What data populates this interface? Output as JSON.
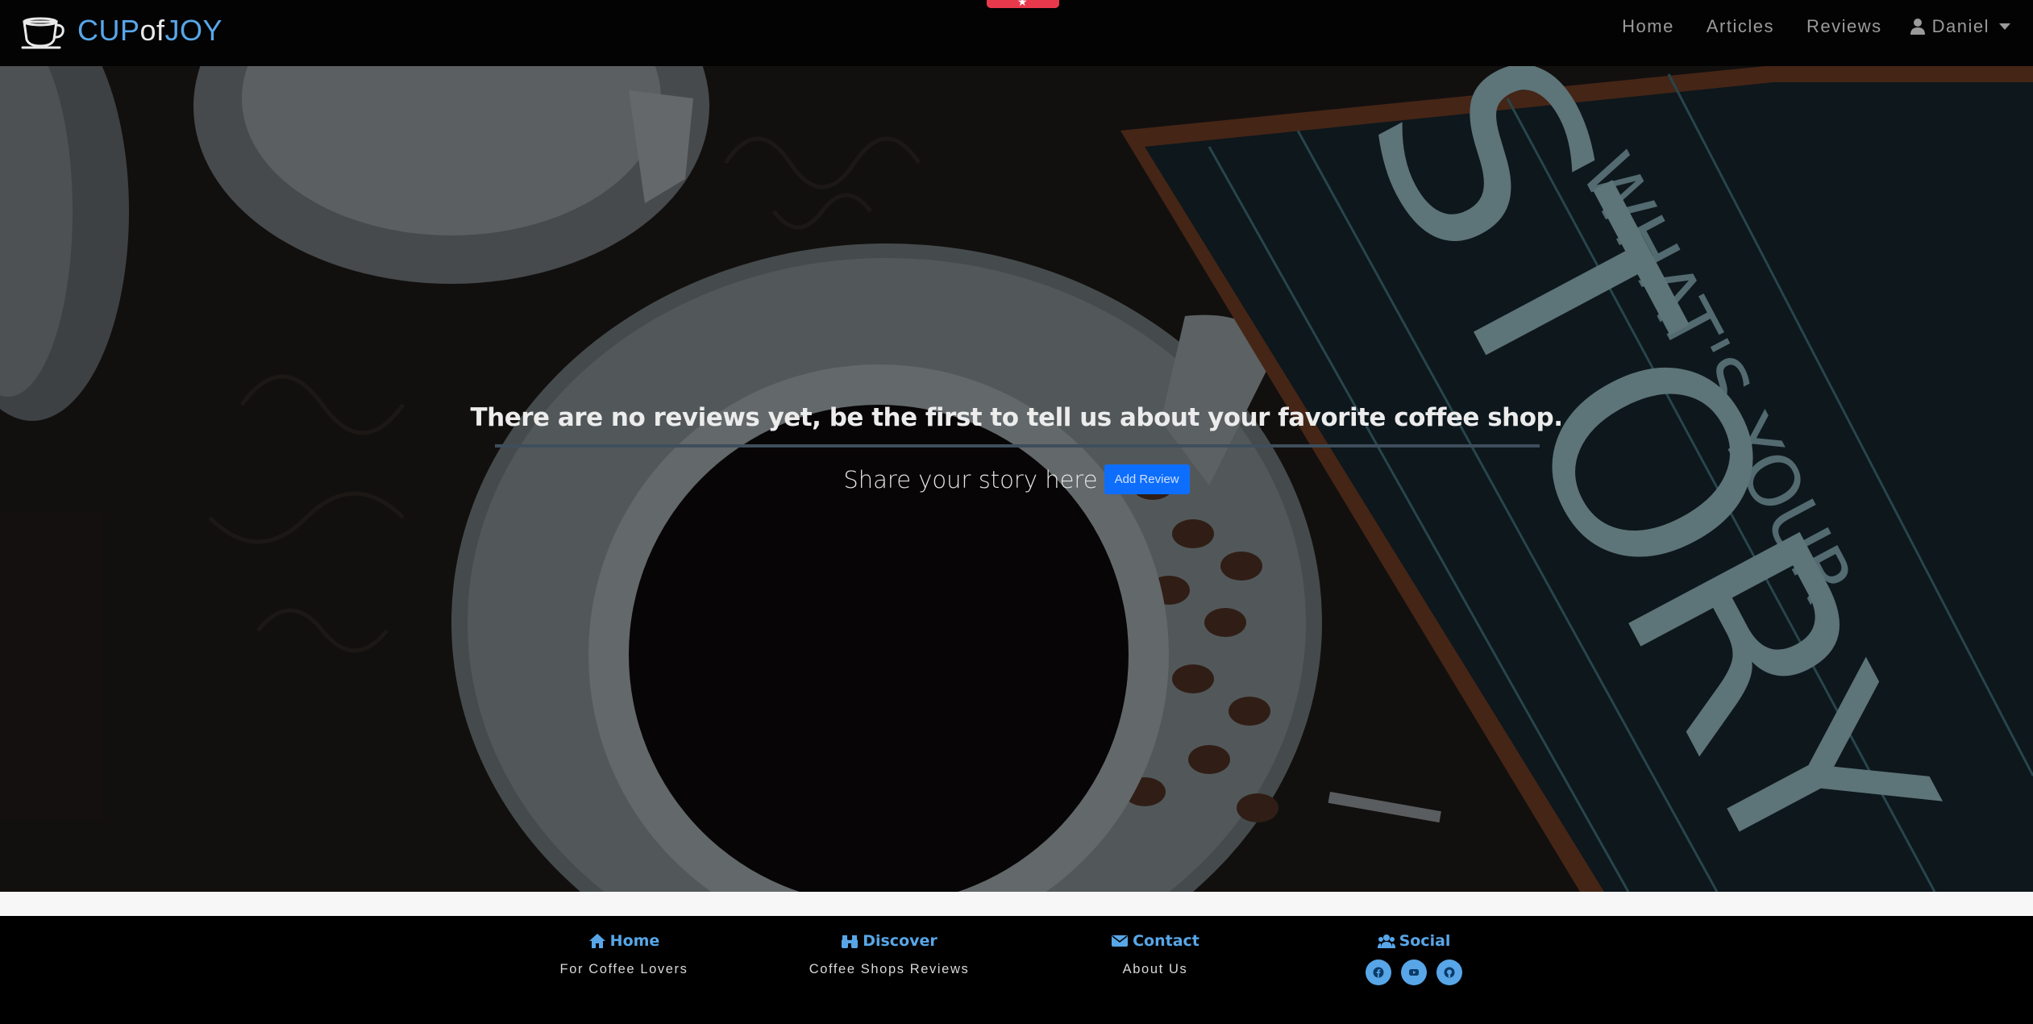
{
  "brand": {
    "part1": "CUP",
    "part2": "of",
    "part3": "JOY"
  },
  "nav": {
    "links": [
      "Home",
      "Articles",
      "Reviews"
    ],
    "user": "Daniel"
  },
  "hero": {
    "heading": "There are no reviews yet, be the first to tell us about your favorite coffee shop.",
    "share_text": "Share your story here",
    "add_review_label": "Add Review",
    "chalkboard_text_1": "WHAT'S YOUR",
    "chalkboard_text_2": "STORY"
  },
  "footer": {
    "columns": [
      {
        "heading": "Home",
        "icon": "home-icon",
        "sub": "For Coffee Lovers"
      },
      {
        "heading": "Discover",
        "icon": "binoculars-icon",
        "sub": "Coffee Shops Reviews"
      },
      {
        "heading": "Contact",
        "icon": "envelope-icon",
        "sub": "About Us"
      },
      {
        "heading": "Social",
        "icon": "users-icon",
        "socials": [
          "facebook-icon",
          "youtube-icon",
          "github-icon"
        ]
      }
    ]
  },
  "colors": {
    "accent": "#58a6e8",
    "button": "#0d6efd",
    "badge": "#e8394c"
  }
}
